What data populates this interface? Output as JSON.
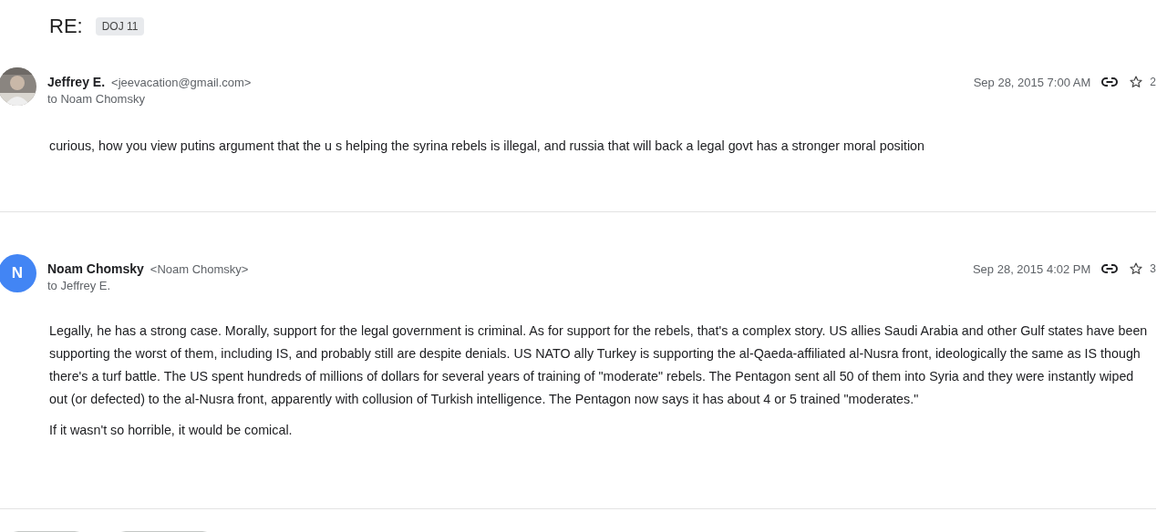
{
  "subject": {
    "title": "RE:",
    "label": "DOJ 11"
  },
  "messages": [
    {
      "sender": "Jeffrey E.",
      "address": "<jeevacation@gmail.com>",
      "recipient": "to Noam Chomsky",
      "date": "Sep 28, 2015 7:00 AM",
      "count": "2",
      "avatar": {
        "kind": "picture"
      },
      "paragraphs": [
        "curious, how you view putins argument that the u s helping the syrina rebels is illegal, and russia that will back a legal govt has a stronger moral position"
      ]
    },
    {
      "sender": "Noam Chomsky",
      "address": "<Noam Chomsky>",
      "recipient": "to Jeffrey E.",
      "date": "Sep 28, 2015 4:02 PM",
      "count": "3",
      "avatar": {
        "kind": "initial",
        "letter": "N",
        "color": "#4285f4"
      },
      "paragraphs": [
        "Legally, he has a strong case. Morally, support for the legal government is criminal. As for support for the rebels, that's a complex story. US allies Saudi Arabia and other Gulf states have been supporting the worst of them, including IS, and probably still are despite denials. US NATO ally Turkey is supporting the al-Qaeda-affiliated al-Nusra front, ideologically the same as IS though there's a turf battle. The US spent hundreds of millions of dollars for several years of training of \"moderate\" rebels. The Pentagon sent all 50 of them into Syria and they were instantly wiped out (or defected) to the al-Nusra front, apparently with collusion of Turkish intelligence. The Pentagon now says it has about 4 or 5 trained \"moderates.\"",
        "If it wasn't so horrible, it would be comical."
      ]
    }
  ]
}
